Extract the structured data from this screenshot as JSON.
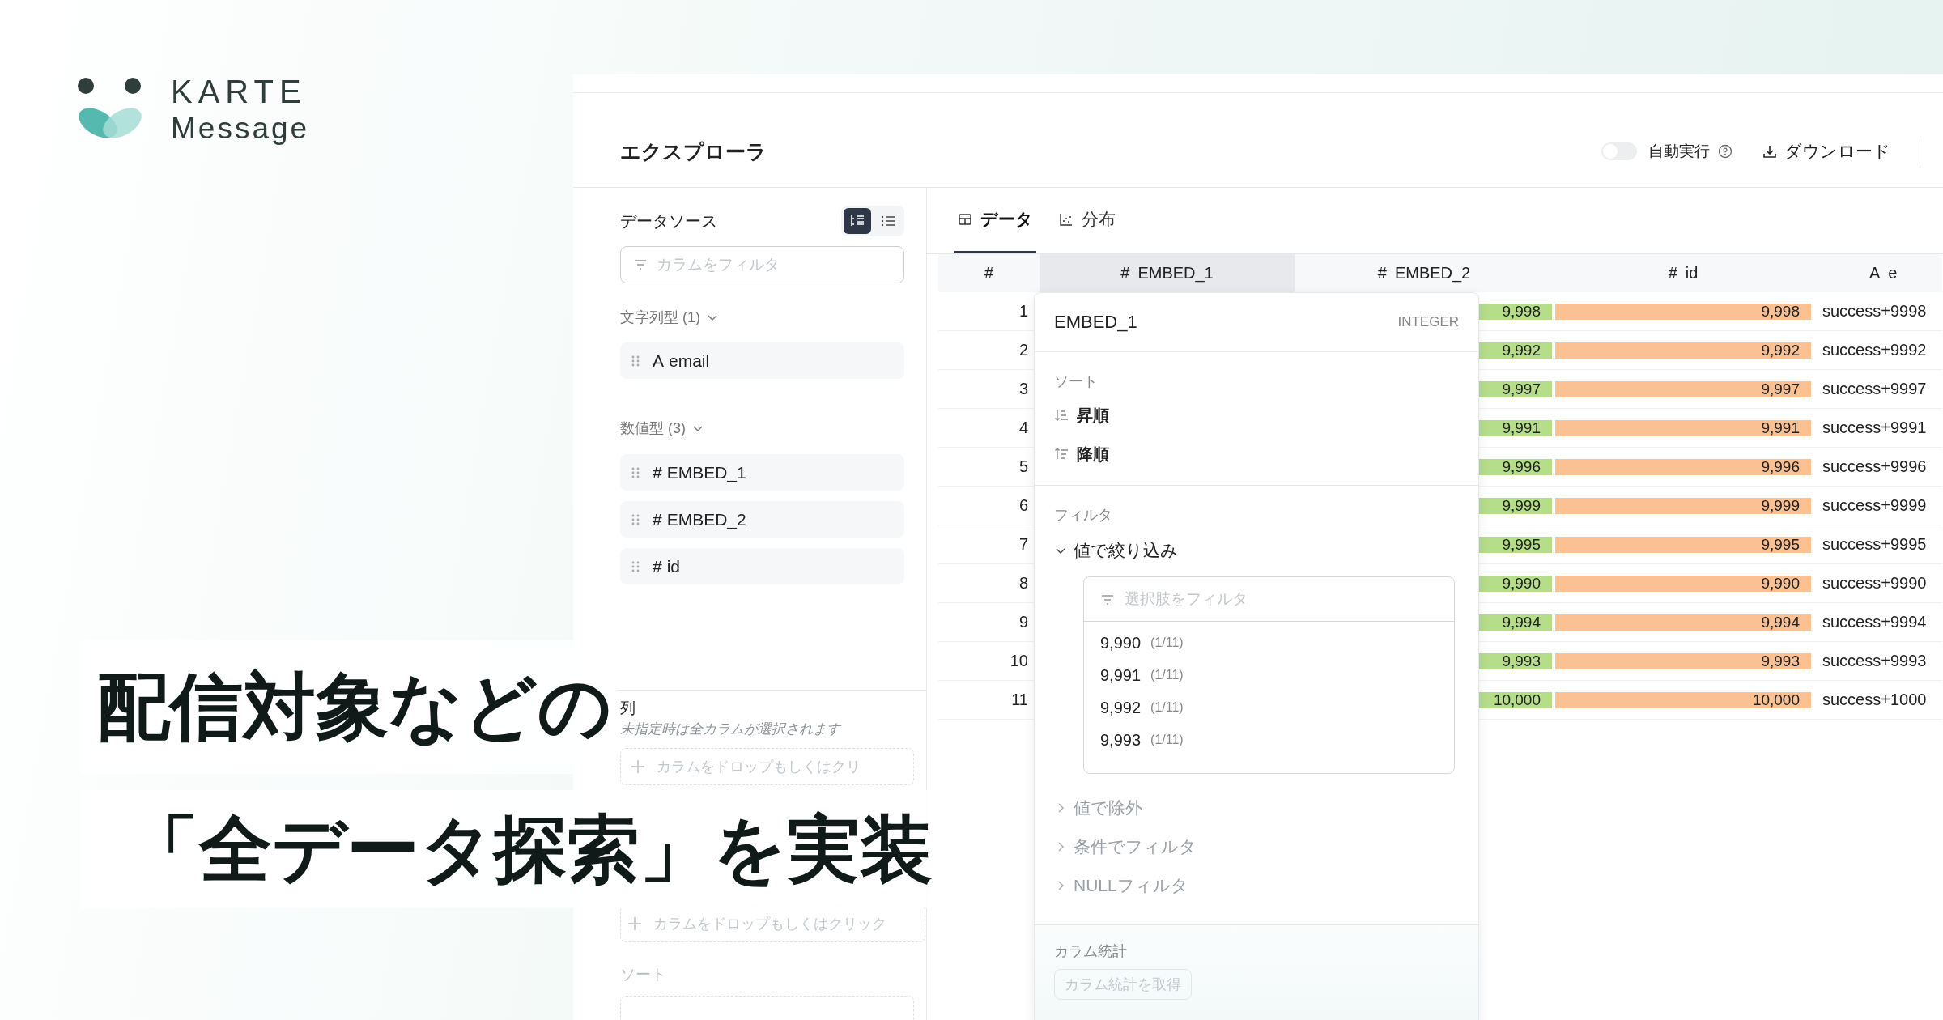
{
  "logo": {
    "brand": "KARTE",
    "product": "Message"
  },
  "headline": [
    "配信対象などの",
    "「全データ探索」を実装"
  ],
  "explorer": {
    "title": "エクスプローラ",
    "auto_run": {
      "label": "自動実行",
      "on": false
    },
    "download": "ダウンロード"
  },
  "sidebar": {
    "title": "データソース",
    "view_modes": [
      {
        "selected": true
      },
      {
        "selected": false
      }
    ],
    "filter_placeholder": "カラムをフィルタ",
    "groups": [
      {
        "label": "文字列型 (1)",
        "expanded": true,
        "items": [
          {
            "icon": "A",
            "name": "email"
          }
        ]
      },
      {
        "label": "数値型 (3)",
        "expanded": true,
        "items": [
          {
            "icon": "#",
            "name": "EMBED_1"
          },
          {
            "icon": "#",
            "name": "EMBED_2"
          },
          {
            "icon": "#",
            "name": "id"
          }
        ]
      }
    ],
    "columns_section": {
      "title": "列",
      "hint": "未指定時は全カラムが選択されます",
      "dropzone": "カラムをドロップもしくはクリ"
    },
    "second_dropzone": "カラムをドロップもしくはクリック",
    "sort_section": {
      "title": "ソート"
    }
  },
  "tabs": [
    {
      "label": "データ",
      "selected": true
    },
    {
      "label": "分布",
      "selected": false
    }
  ],
  "table": {
    "columns": [
      {
        "label": "#",
        "selected": false
      },
      {
        "icon": "#",
        "label": "EMBED_1",
        "selected": true
      },
      {
        "icon": "#",
        "label": "EMBED_2",
        "selected": false
      },
      {
        "icon": "#",
        "label": "id",
        "selected": false
      },
      {
        "icon": "A",
        "label": "e",
        "selected": false
      }
    ],
    "rows": [
      {
        "n": "1",
        "embed_2": "9,998",
        "id": "9,998",
        "email": "success+9998"
      },
      {
        "n": "2",
        "embed_2": "9,992",
        "id": "9,992",
        "email": "success+9992"
      },
      {
        "n": "3",
        "embed_2": "9,997",
        "id": "9,997",
        "email": "success+9997"
      },
      {
        "n": "4",
        "embed_2": "9,991",
        "id": "9,991",
        "email": "success+9991"
      },
      {
        "n": "5",
        "embed_2": "9,996",
        "id": "9,996",
        "email": "success+9996"
      },
      {
        "n": "6",
        "embed_2": "9,999",
        "id": "9,999",
        "email": "success+9999"
      },
      {
        "n": "7",
        "embed_2": "9,995",
        "id": "9,995",
        "email": "success+9995"
      },
      {
        "n": "8",
        "embed_2": "9,990",
        "id": "9,990",
        "email": "success+9990"
      },
      {
        "n": "9",
        "embed_2": "9,994",
        "id": "9,994",
        "email": "success+9994"
      },
      {
        "n": "10",
        "embed_2": "9,993",
        "id": "9,993",
        "email": "success+9993"
      },
      {
        "n": "11",
        "embed_2": "10,000",
        "id": "10,000",
        "email": "success+1000"
      }
    ]
  },
  "column_menu": {
    "title": "EMBED_1",
    "type": "INTEGER",
    "sort_label": "ソート",
    "sort_options": [
      "昇順",
      "降順"
    ],
    "filter_label": "フィルタ",
    "filters": [
      {
        "label": "値で絞り込み",
        "expanded": true
      },
      {
        "label": "値で除外",
        "expanded": false
      },
      {
        "label": "条件でフィルタ",
        "expanded": false
      },
      {
        "label": "NULLフィルタ",
        "expanded": false
      }
    ],
    "option_placeholder": "選択肢をフィルタ",
    "options": [
      {
        "value": "9,990",
        "count": "(1/11)"
      },
      {
        "value": "9,991",
        "count": "(1/11)"
      },
      {
        "value": "9,992",
        "count": "(1/11)"
      },
      {
        "value": "9,993",
        "count": "(1/11)"
      }
    ],
    "stats_label": "カラム統計",
    "stats_button": "カラム統計を取得"
  }
}
